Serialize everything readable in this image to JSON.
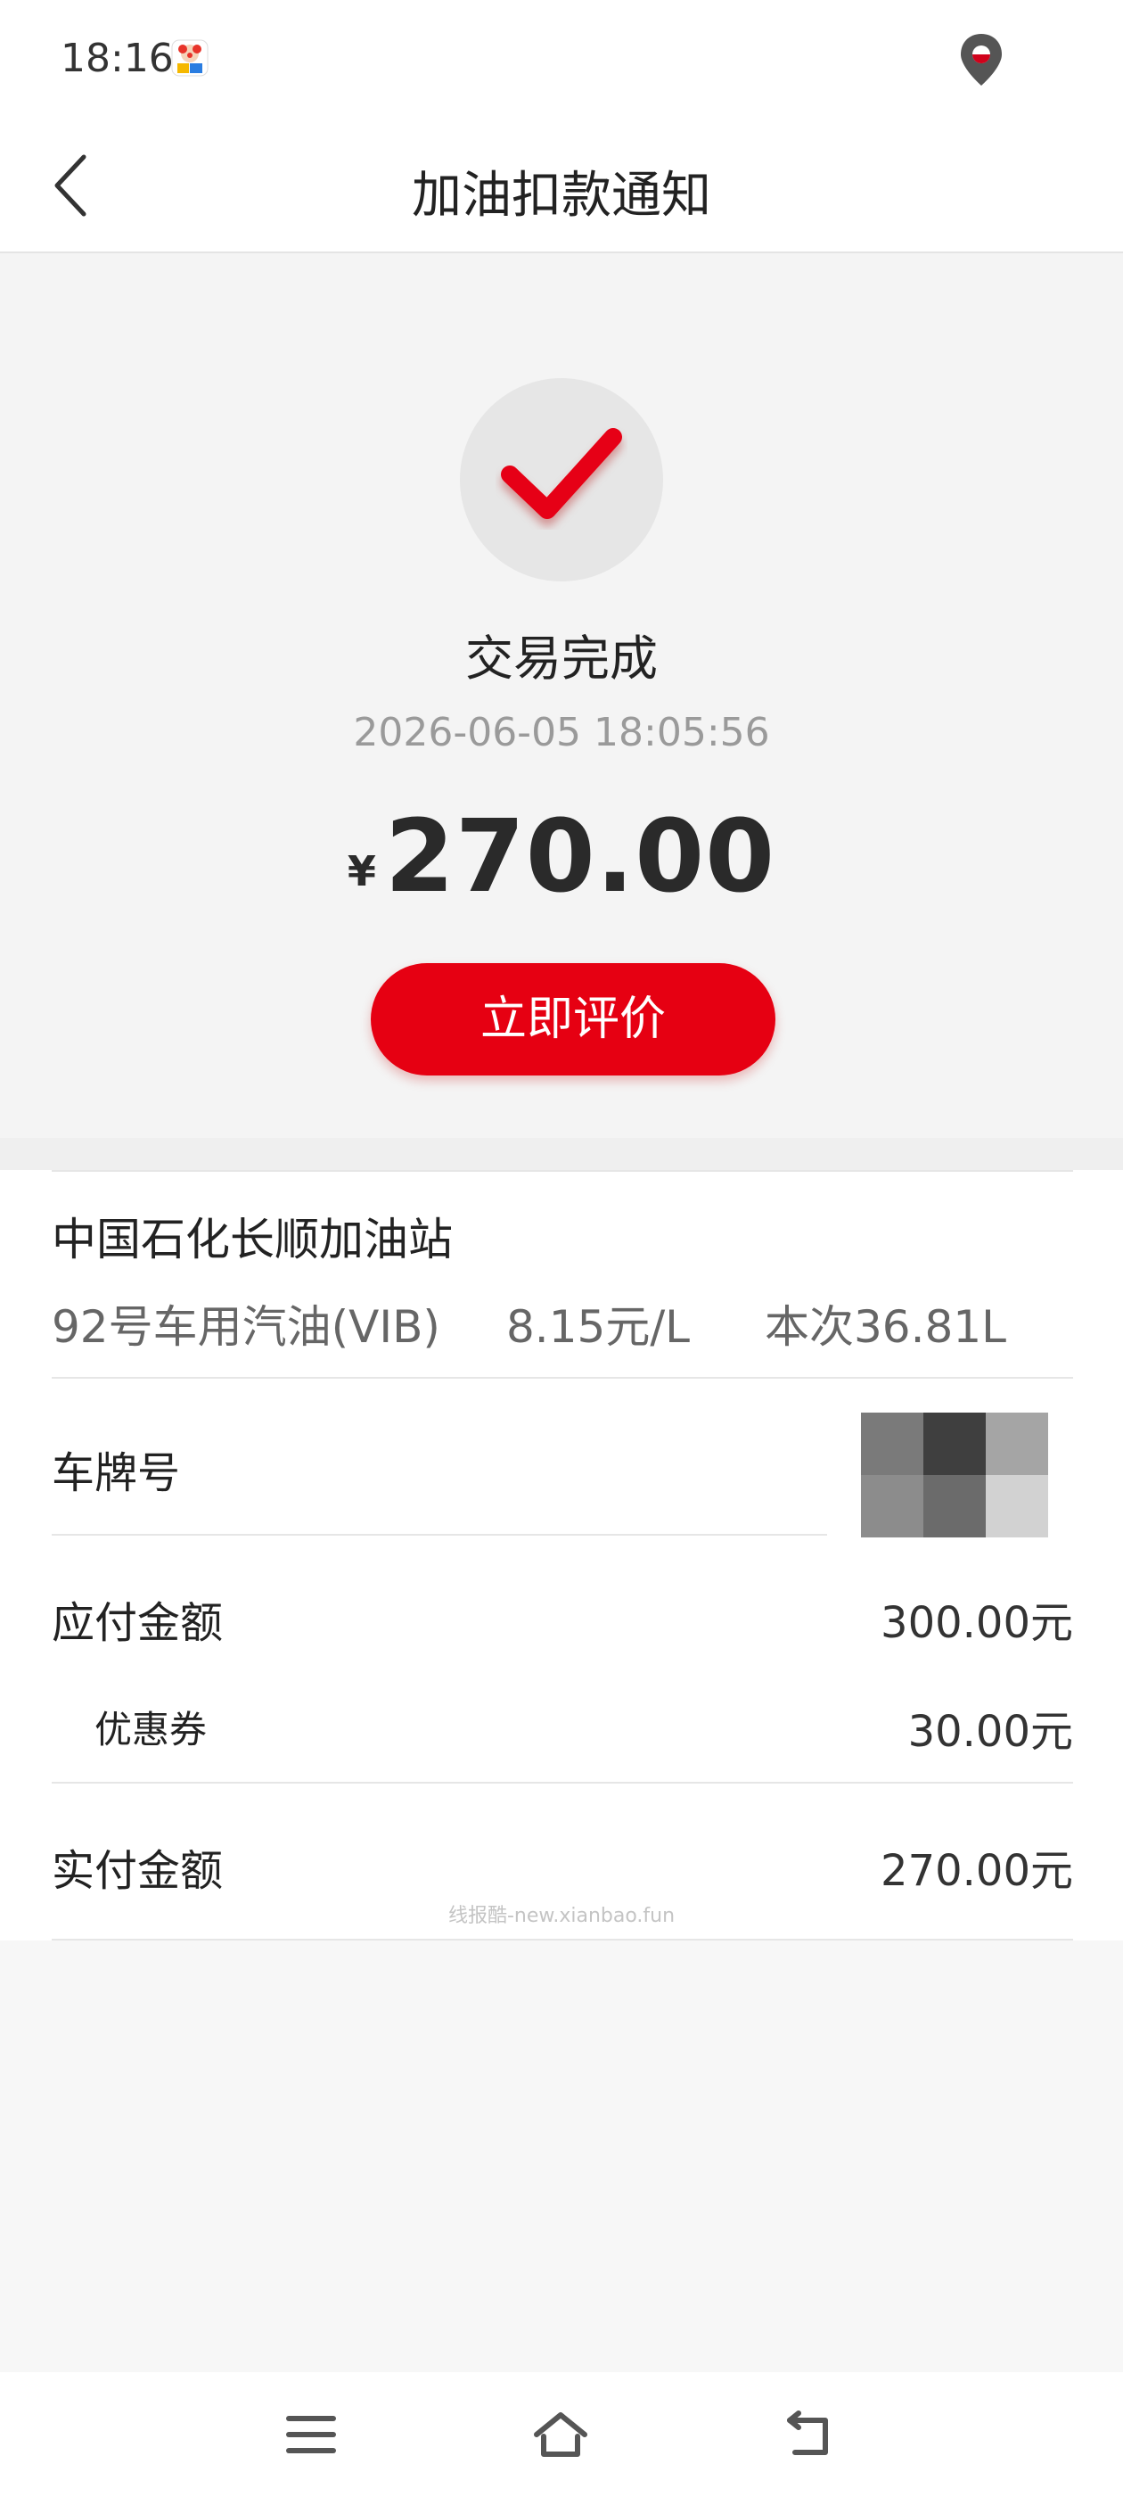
{
  "status_bar": {
    "time": "18:16",
    "app_icon": "clown-app-icon",
    "location_icon": "location-pin-icon"
  },
  "header": {
    "title": "加油扣款通知",
    "back_icon": "chevron-left-icon"
  },
  "transaction": {
    "status_icon": "checkmark-icon",
    "status": "交易完成",
    "datetime": "2026-06-05 18:05:56",
    "currency_symbol": "¥",
    "amount": "270.00",
    "rate_button_label": "立即评价"
  },
  "station": {
    "name": "中国石化长顺加油站",
    "fuel_grade": "92号车用汽油(VIB)",
    "unit_price": "8.15元/L",
    "volume": "本次36.81L"
  },
  "details": {
    "plate_label": "车牌号",
    "payable_label": "应付金额",
    "payable_value": "300.00元",
    "coupon_label": "优惠券",
    "coupon_value": "30.00元",
    "paid_label": "实付金额",
    "paid_value": "270.00元"
  },
  "watermark": "线报酷-new.xianbao.fun",
  "bottom_nav": {
    "menu_icon": "menu-icon",
    "home_icon": "home-icon",
    "back_icon": "back-arrow-icon"
  },
  "colors": {
    "accent_red": "#e60012",
    "background": "#f7f7f7"
  }
}
